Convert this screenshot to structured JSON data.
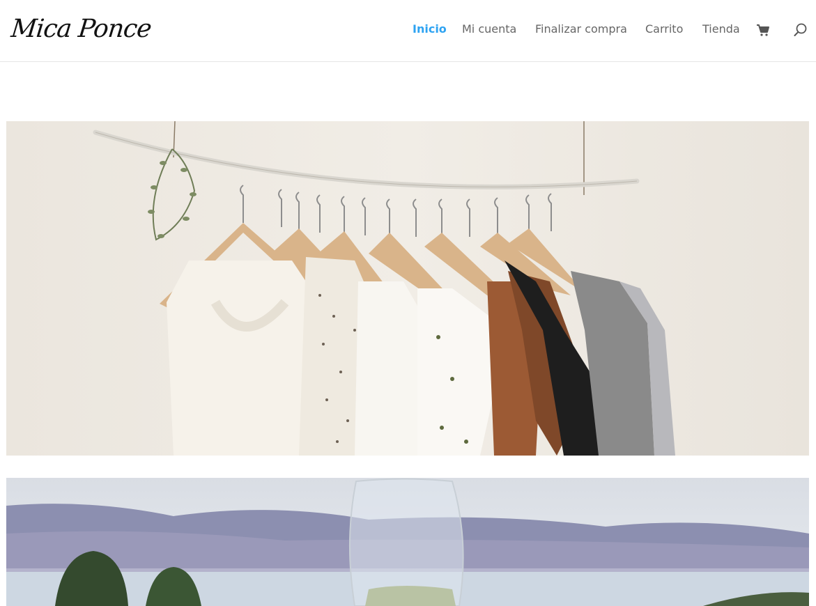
{
  "site": {
    "logo_text": "Mica Ponce"
  },
  "nav": {
    "items": [
      {
        "label": "Inicio",
        "active": true
      },
      {
        "label": "Mi cuenta",
        "active": false
      },
      {
        "label": "Finalizar compra",
        "active": false
      },
      {
        "label": "Carrito",
        "active": false
      },
      {
        "label": "Tienda",
        "active": false
      }
    ],
    "cart_icon": "shopping-cart-icon",
    "search_icon": "search-icon"
  },
  "colors": {
    "accent": "#2ea3f2",
    "nav_text": "#666666",
    "header_border": "#e6e6e6"
  },
  "hero_images": [
    {
      "subject": "clothes-on-hangers"
    },
    {
      "subject": "wine-glass-lake"
    }
  ]
}
